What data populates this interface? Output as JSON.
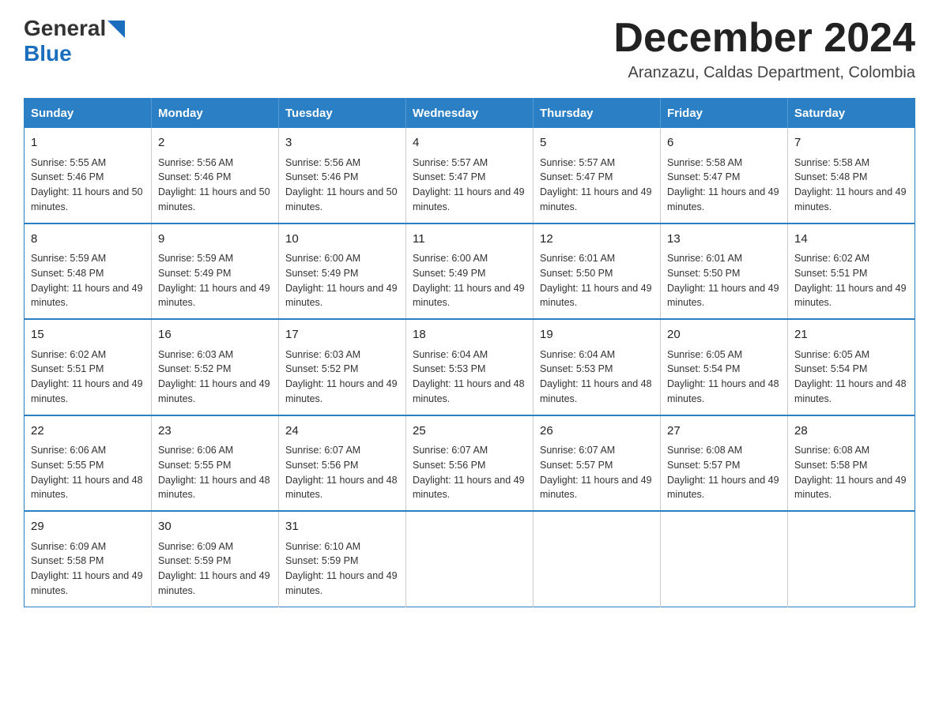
{
  "header": {
    "logo_general": "General",
    "logo_blue": "Blue",
    "title": "December 2024",
    "subtitle": "Aranzazu, Caldas Department, Colombia"
  },
  "calendar": {
    "days_of_week": [
      "Sunday",
      "Monday",
      "Tuesday",
      "Wednesday",
      "Thursday",
      "Friday",
      "Saturday"
    ],
    "weeks": [
      [
        {
          "day": "1",
          "sunrise": "Sunrise: 5:55 AM",
          "sunset": "Sunset: 5:46 PM",
          "daylight": "Daylight: 11 hours and 50 minutes."
        },
        {
          "day": "2",
          "sunrise": "Sunrise: 5:56 AM",
          "sunset": "Sunset: 5:46 PM",
          "daylight": "Daylight: 11 hours and 50 minutes."
        },
        {
          "day": "3",
          "sunrise": "Sunrise: 5:56 AM",
          "sunset": "Sunset: 5:46 PM",
          "daylight": "Daylight: 11 hours and 50 minutes."
        },
        {
          "day": "4",
          "sunrise": "Sunrise: 5:57 AM",
          "sunset": "Sunset: 5:47 PM",
          "daylight": "Daylight: 11 hours and 49 minutes."
        },
        {
          "day": "5",
          "sunrise": "Sunrise: 5:57 AM",
          "sunset": "Sunset: 5:47 PM",
          "daylight": "Daylight: 11 hours and 49 minutes."
        },
        {
          "day": "6",
          "sunrise": "Sunrise: 5:58 AM",
          "sunset": "Sunset: 5:47 PM",
          "daylight": "Daylight: 11 hours and 49 minutes."
        },
        {
          "day": "7",
          "sunrise": "Sunrise: 5:58 AM",
          "sunset": "Sunset: 5:48 PM",
          "daylight": "Daylight: 11 hours and 49 minutes."
        }
      ],
      [
        {
          "day": "8",
          "sunrise": "Sunrise: 5:59 AM",
          "sunset": "Sunset: 5:48 PM",
          "daylight": "Daylight: 11 hours and 49 minutes."
        },
        {
          "day": "9",
          "sunrise": "Sunrise: 5:59 AM",
          "sunset": "Sunset: 5:49 PM",
          "daylight": "Daylight: 11 hours and 49 minutes."
        },
        {
          "day": "10",
          "sunrise": "Sunrise: 6:00 AM",
          "sunset": "Sunset: 5:49 PM",
          "daylight": "Daylight: 11 hours and 49 minutes."
        },
        {
          "day": "11",
          "sunrise": "Sunrise: 6:00 AM",
          "sunset": "Sunset: 5:49 PM",
          "daylight": "Daylight: 11 hours and 49 minutes."
        },
        {
          "day": "12",
          "sunrise": "Sunrise: 6:01 AM",
          "sunset": "Sunset: 5:50 PM",
          "daylight": "Daylight: 11 hours and 49 minutes."
        },
        {
          "day": "13",
          "sunrise": "Sunrise: 6:01 AM",
          "sunset": "Sunset: 5:50 PM",
          "daylight": "Daylight: 11 hours and 49 minutes."
        },
        {
          "day": "14",
          "sunrise": "Sunrise: 6:02 AM",
          "sunset": "Sunset: 5:51 PM",
          "daylight": "Daylight: 11 hours and 49 minutes."
        }
      ],
      [
        {
          "day": "15",
          "sunrise": "Sunrise: 6:02 AM",
          "sunset": "Sunset: 5:51 PM",
          "daylight": "Daylight: 11 hours and 49 minutes."
        },
        {
          "day": "16",
          "sunrise": "Sunrise: 6:03 AM",
          "sunset": "Sunset: 5:52 PM",
          "daylight": "Daylight: 11 hours and 49 minutes."
        },
        {
          "day": "17",
          "sunrise": "Sunrise: 6:03 AM",
          "sunset": "Sunset: 5:52 PM",
          "daylight": "Daylight: 11 hours and 49 minutes."
        },
        {
          "day": "18",
          "sunrise": "Sunrise: 6:04 AM",
          "sunset": "Sunset: 5:53 PM",
          "daylight": "Daylight: 11 hours and 48 minutes."
        },
        {
          "day": "19",
          "sunrise": "Sunrise: 6:04 AM",
          "sunset": "Sunset: 5:53 PM",
          "daylight": "Daylight: 11 hours and 48 minutes."
        },
        {
          "day": "20",
          "sunrise": "Sunrise: 6:05 AM",
          "sunset": "Sunset: 5:54 PM",
          "daylight": "Daylight: 11 hours and 48 minutes."
        },
        {
          "day": "21",
          "sunrise": "Sunrise: 6:05 AM",
          "sunset": "Sunset: 5:54 PM",
          "daylight": "Daylight: 11 hours and 48 minutes."
        }
      ],
      [
        {
          "day": "22",
          "sunrise": "Sunrise: 6:06 AM",
          "sunset": "Sunset: 5:55 PM",
          "daylight": "Daylight: 11 hours and 48 minutes."
        },
        {
          "day": "23",
          "sunrise": "Sunrise: 6:06 AM",
          "sunset": "Sunset: 5:55 PM",
          "daylight": "Daylight: 11 hours and 48 minutes."
        },
        {
          "day": "24",
          "sunrise": "Sunrise: 6:07 AM",
          "sunset": "Sunset: 5:56 PM",
          "daylight": "Daylight: 11 hours and 48 minutes."
        },
        {
          "day": "25",
          "sunrise": "Sunrise: 6:07 AM",
          "sunset": "Sunset: 5:56 PM",
          "daylight": "Daylight: 11 hours and 49 minutes."
        },
        {
          "day": "26",
          "sunrise": "Sunrise: 6:07 AM",
          "sunset": "Sunset: 5:57 PM",
          "daylight": "Daylight: 11 hours and 49 minutes."
        },
        {
          "day": "27",
          "sunrise": "Sunrise: 6:08 AM",
          "sunset": "Sunset: 5:57 PM",
          "daylight": "Daylight: 11 hours and 49 minutes."
        },
        {
          "day": "28",
          "sunrise": "Sunrise: 6:08 AM",
          "sunset": "Sunset: 5:58 PM",
          "daylight": "Daylight: 11 hours and 49 minutes."
        }
      ],
      [
        {
          "day": "29",
          "sunrise": "Sunrise: 6:09 AM",
          "sunset": "Sunset: 5:58 PM",
          "daylight": "Daylight: 11 hours and 49 minutes."
        },
        {
          "day": "30",
          "sunrise": "Sunrise: 6:09 AM",
          "sunset": "Sunset: 5:59 PM",
          "daylight": "Daylight: 11 hours and 49 minutes."
        },
        {
          "day": "31",
          "sunrise": "Sunrise: 6:10 AM",
          "sunset": "Sunset: 5:59 PM",
          "daylight": "Daylight: 11 hours and 49 minutes."
        },
        null,
        null,
        null,
        null
      ]
    ]
  }
}
